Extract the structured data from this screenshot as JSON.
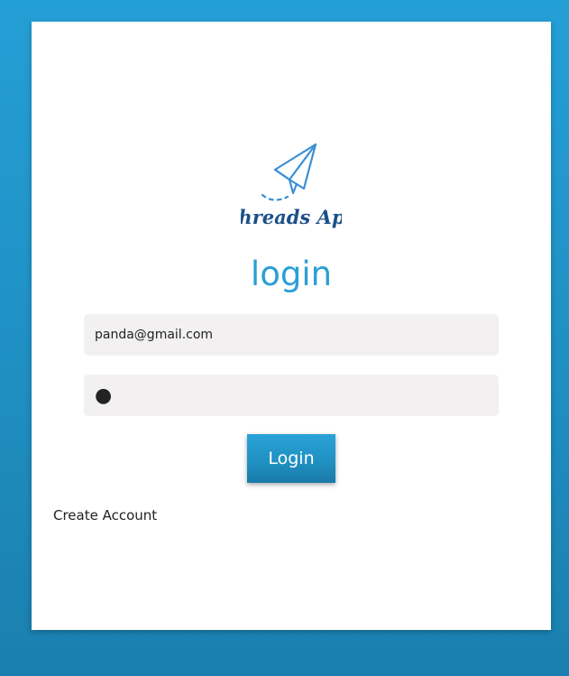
{
  "app": {
    "logo_text": "Threads App",
    "logo_icon": "paper-plane-icon"
  },
  "login": {
    "title": "login",
    "email_value": "panda@gmail.com",
    "password_value": "●",
    "button_label": "Login",
    "create_account_label": "Create Account"
  },
  "colors": {
    "accent": "#2b9fd5",
    "background": "#1f8fc2",
    "logo_ink": "#1b4f8a",
    "field_bg": "#f2f0f0"
  }
}
